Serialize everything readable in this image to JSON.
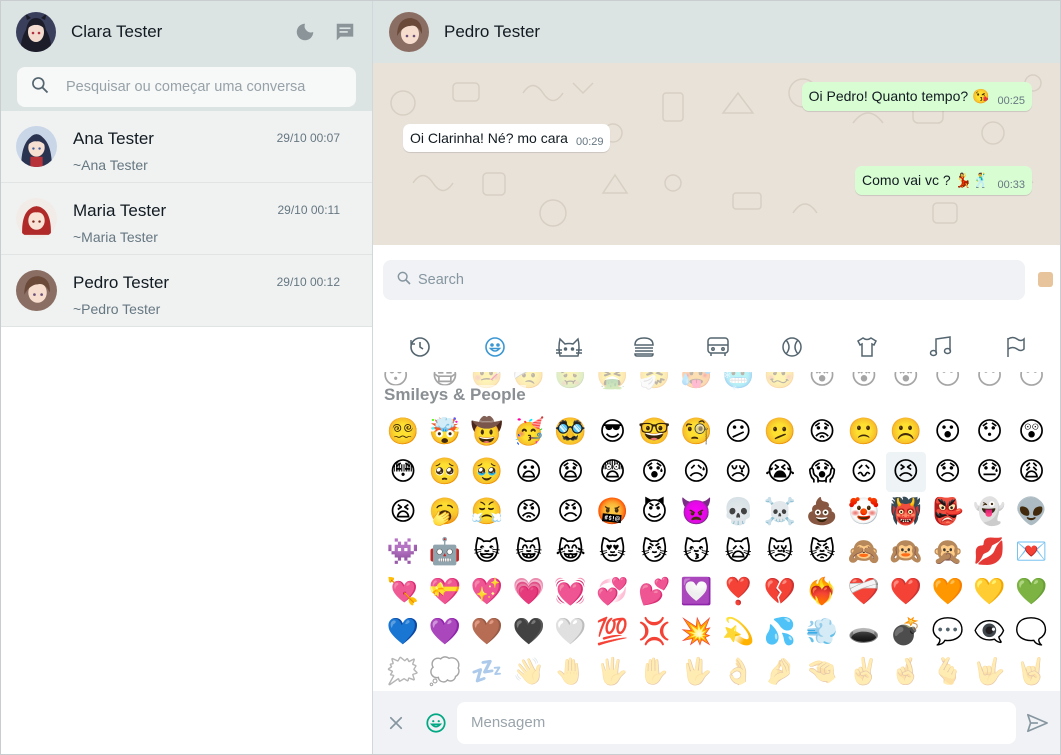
{
  "sidebar": {
    "user_name": "Clara Tester",
    "search_placeholder": "Pesquisar ou começar uma conversa",
    "chats": [
      {
        "name": "Ana Tester",
        "time": "29/10 00:07",
        "last": "~Ana Tester"
      },
      {
        "name": "Maria Tester",
        "time": "29/10 00:11",
        "last": "~Maria Tester"
      },
      {
        "name": "Pedro Tester",
        "time": "29/10 00:12",
        "last": "~Pedro Tester"
      }
    ]
  },
  "conversation": {
    "contact_name": "Pedro Tester",
    "messages": [
      {
        "direction": "out",
        "text": "Oi Pedro! Quanto tempo? 😘",
        "time": "00:25"
      },
      {
        "direction": "in",
        "text": "Oi Clarinha! Né? mo cara",
        "time": "00:29"
      },
      {
        "direction": "out",
        "text": "Como vai vc ? 💃🕺",
        "time": "00:33"
      }
    ]
  },
  "emoji_picker": {
    "search_placeholder": "Search",
    "section_title": "Smileys & People",
    "categories": [
      "recent-icon",
      "smileys-icon",
      "animals-icon",
      "food-icon",
      "travel-icon",
      "activity-icon",
      "objects-icon",
      "symbols-icon",
      "flags-icon"
    ],
    "active_category": "smileys-icon",
    "rows": [
      [
        "😴",
        "😷",
        "🤒",
        "🤕",
        "🤢",
        "🤮",
        "🤧",
        "🥵",
        "🥶",
        "🥴",
        "😵",
        "😵",
        "😵",
        "😶",
        "😶",
        "😶"
      ],
      [
        "😵‍💫",
        "🤯",
        "🤠",
        "🥳",
        "🥸",
        "😎",
        "🤓",
        "🧐",
        "😕",
        "🫤",
        "😟",
        "🙁",
        "☹️",
        "😮",
        "😯",
        "😲"
      ],
      [
        "😳",
        "🥺",
        "🥹",
        "😦",
        "😧",
        "😨",
        "😰",
        "😥",
        "😢",
        "😭",
        "😱",
        "😖",
        "😣",
        "😞",
        "😓",
        "😩"
      ],
      [
        "😫",
        "🥱",
        "😤",
        "😡",
        "😠",
        "🤬",
        "😈",
        "👿",
        "💀",
        "☠️",
        "💩",
        "🤡",
        "👹",
        "👺",
        "👻",
        "👽"
      ],
      [
        "👾",
        "🤖",
        "😺",
        "😸",
        "😹",
        "😻",
        "😼",
        "😽",
        "🙀",
        "😿",
        "😾",
        "🙈",
        "🙉",
        "🙊",
        "💋",
        "💌"
      ],
      [
        "💘",
        "💝",
        "💖",
        "💗",
        "💓",
        "💞",
        "💕",
        "💟",
        "❣️",
        "💔",
        "❤️‍🔥",
        "❤️‍🩹",
        "❤️",
        "🧡",
        "💛",
        "💚"
      ],
      [
        "💙",
        "💜",
        "🤎",
        "🖤",
        "🤍",
        "💯",
        "💢",
        "💥",
        "💫",
        "💦",
        "💨",
        "🕳️",
        "💣",
        "💬",
        "👁️‍🗨️",
        "🗨️"
      ],
      [
        "🗯️",
        "💭",
        "💤",
        "👋",
        "🤚",
        "🖐️",
        "✋",
        "🖖",
        "👌",
        "🤌",
        "🤏",
        "✌️",
        "🤞",
        "🫰",
        "🤟",
        "🤘"
      ]
    ]
  },
  "composer": {
    "placeholder": "Mensagem"
  }
}
